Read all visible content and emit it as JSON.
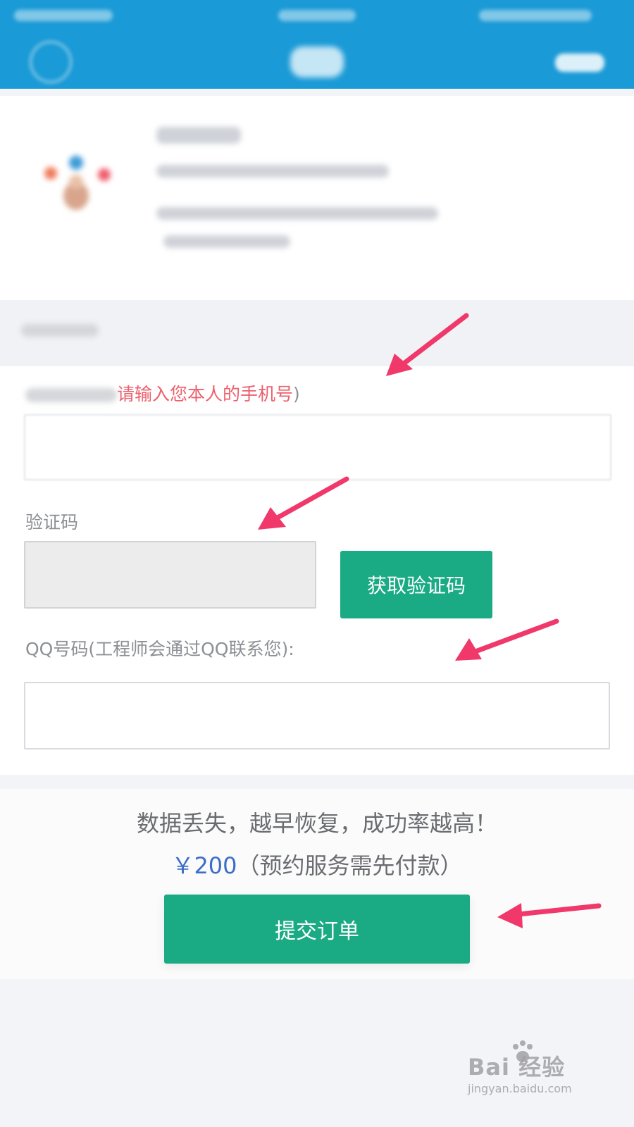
{
  "form": {
    "phone_label_hint": "请输入您本人的手机号",
    "phone_label_close": ")",
    "code_label": "验证码",
    "get_code_button": "获取验证码",
    "qq_label": "QQ号码(工程师会通过QQ联系您):"
  },
  "footer": {
    "slogan": "数据丢失，越早恢复，成功率越高！",
    "price": "￥200",
    "price_note": "（预约服务需先付款）",
    "submit_button": "提交订单"
  },
  "watermark": {
    "brand": "Bai  经验",
    "url": "jingyan.baidu.com"
  },
  "colors": {
    "header": "#1a9ad6",
    "primary_button": "#1aaa84",
    "hint_text": "#ec5f6c",
    "price_text": "#3c6fc4",
    "arrow": "#f0386a"
  }
}
